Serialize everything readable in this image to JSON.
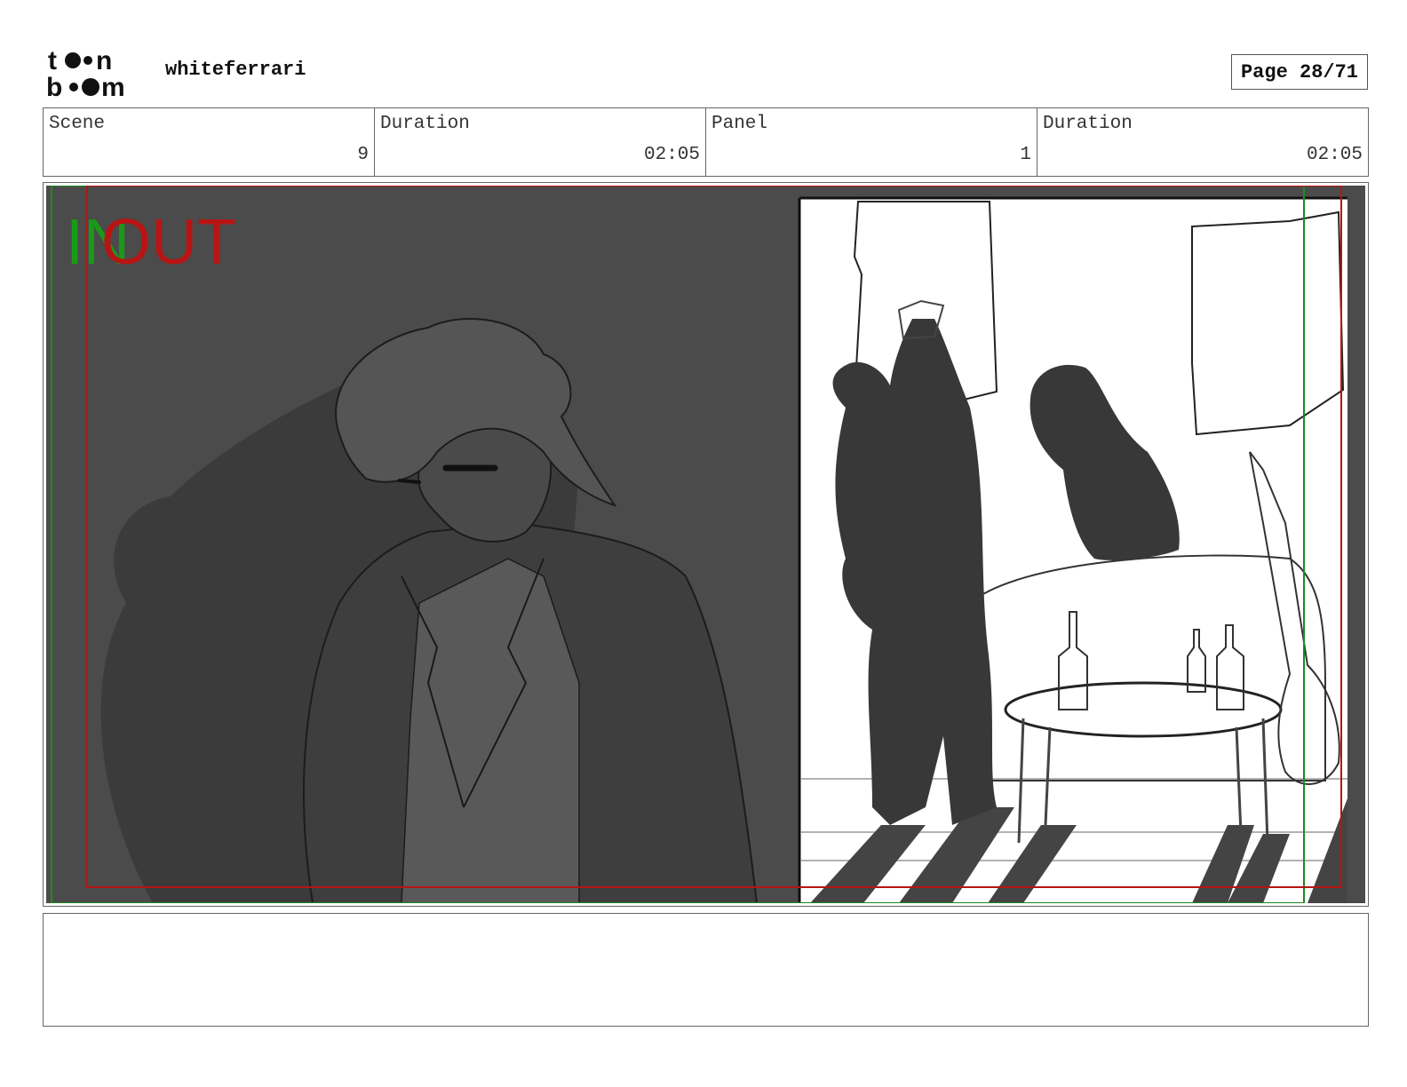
{
  "header": {
    "logo_text": "toonboom",
    "project_name": "whiteferrari",
    "page_label": "Page 28/71"
  },
  "info": {
    "scene": {
      "label": "Scene",
      "value": "9"
    },
    "scene_duration": {
      "label": "Duration",
      "value": "02:05"
    },
    "panel": {
      "label": "Panel",
      "value": "1"
    },
    "panel_duration": {
      "label": "Duration",
      "value": "02:05"
    }
  },
  "frame": {
    "in_marker": "IN",
    "out_marker": "OUT",
    "in_color": "#1a9a1a",
    "out_color": "#b81414"
  },
  "notes": {
    "text": ""
  }
}
